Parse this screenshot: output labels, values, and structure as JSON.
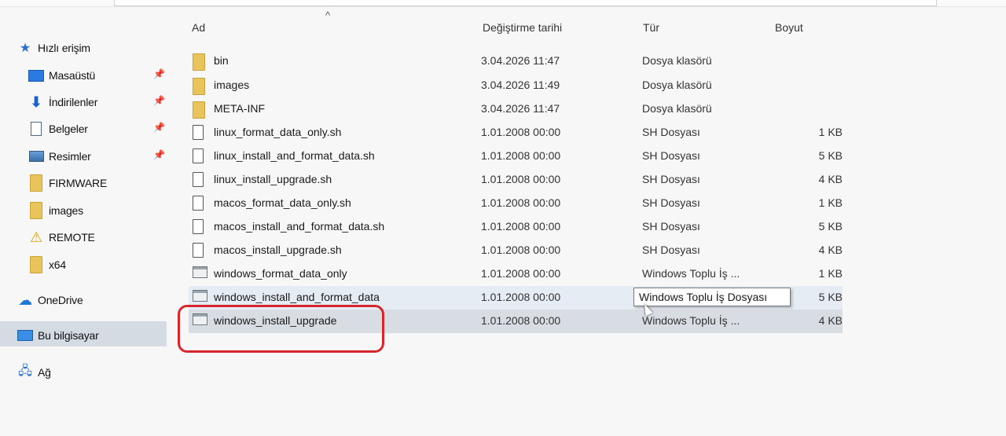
{
  "columns": {
    "name": "Ad",
    "modified": "Değiştirme tarihi",
    "type": "Tür",
    "size": "Boyut"
  },
  "sidebar": {
    "quick_access": "Hızlı erişim",
    "items": [
      {
        "label": "Masaüstü",
        "icon": "desktop-icon",
        "pinned": true
      },
      {
        "label": "İndirilenler",
        "icon": "download-icon",
        "pinned": true
      },
      {
        "label": "Belgeler",
        "icon": "documents-icon",
        "pinned": true
      },
      {
        "label": "Resimler",
        "icon": "pictures-icon",
        "pinned": true
      },
      {
        "label": "FIRMWARE",
        "icon": "folder-icon",
        "pinned": false
      },
      {
        "label": "images",
        "icon": "folder-icon",
        "pinned": false
      },
      {
        "label": "REMOTE",
        "icon": "warning-icon",
        "pinned": false
      },
      {
        "label": "x64",
        "icon": "folder-icon",
        "pinned": false
      }
    ],
    "onedrive": "OneDrive",
    "this_pc": "Bu bilgisayar",
    "network": "Ağ"
  },
  "files": [
    {
      "name": "bin",
      "modified": "3.04.2026 11:47",
      "type": "Dosya klasörü",
      "size": "",
      "icon": "folder"
    },
    {
      "name": "images",
      "modified": "3.04.2026 11:49",
      "type": "Dosya klasörü",
      "size": "",
      "icon": "folder"
    },
    {
      "name": "META-INF",
      "modified": "3.04.2026 11:47",
      "type": "Dosya klasörü",
      "size": "",
      "icon": "folder"
    },
    {
      "name": "linux_format_data_only.sh",
      "modified": "1.01.2008 00:00",
      "type": "SH Dosyası",
      "size": "1 KB",
      "icon": "file"
    },
    {
      "name": "linux_install_and_format_data.sh",
      "modified": "1.01.2008 00:00",
      "type": "SH Dosyası",
      "size": "5 KB",
      "icon": "file"
    },
    {
      "name": "linux_install_upgrade.sh",
      "modified": "1.01.2008 00:00",
      "type": "SH Dosyası",
      "size": "4 KB",
      "icon": "file"
    },
    {
      "name": "macos_format_data_only.sh",
      "modified": "1.01.2008 00:00",
      "type": "SH Dosyası",
      "size": "1 KB",
      "icon": "file"
    },
    {
      "name": "macos_install_and_format_data.sh",
      "modified": "1.01.2008 00:00",
      "type": "SH Dosyası",
      "size": "5 KB",
      "icon": "file"
    },
    {
      "name": "macos_install_upgrade.sh",
      "modified": "1.01.2008 00:00",
      "type": "SH Dosyası",
      "size": "4 KB",
      "icon": "file"
    },
    {
      "name": "windows_format_data_only",
      "modified": "1.01.2008 00:00",
      "type": "Windows Toplu İş ...",
      "size": "1 KB",
      "icon": "batch"
    },
    {
      "name": "windows_install_and_format_data",
      "modified": "1.01.2008 00:00",
      "type": "Windows Toplu İş Dosyası",
      "size": "5 KB",
      "icon": "batch"
    },
    {
      "name": "windows_install_upgrade",
      "modified": "1.01.2008 00:00",
      "type": "Windows Toplu İş ...",
      "size": "4 KB",
      "icon": "batch"
    }
  ],
  "tooltip": "Windows Toplu İş Dosyası",
  "colors": {
    "highlight": "#d8272c",
    "selected_row": "#d8dde3",
    "hover_row": "#e5ecf3",
    "folder": "#e8c45a",
    "accent": "#1e6fd0"
  }
}
